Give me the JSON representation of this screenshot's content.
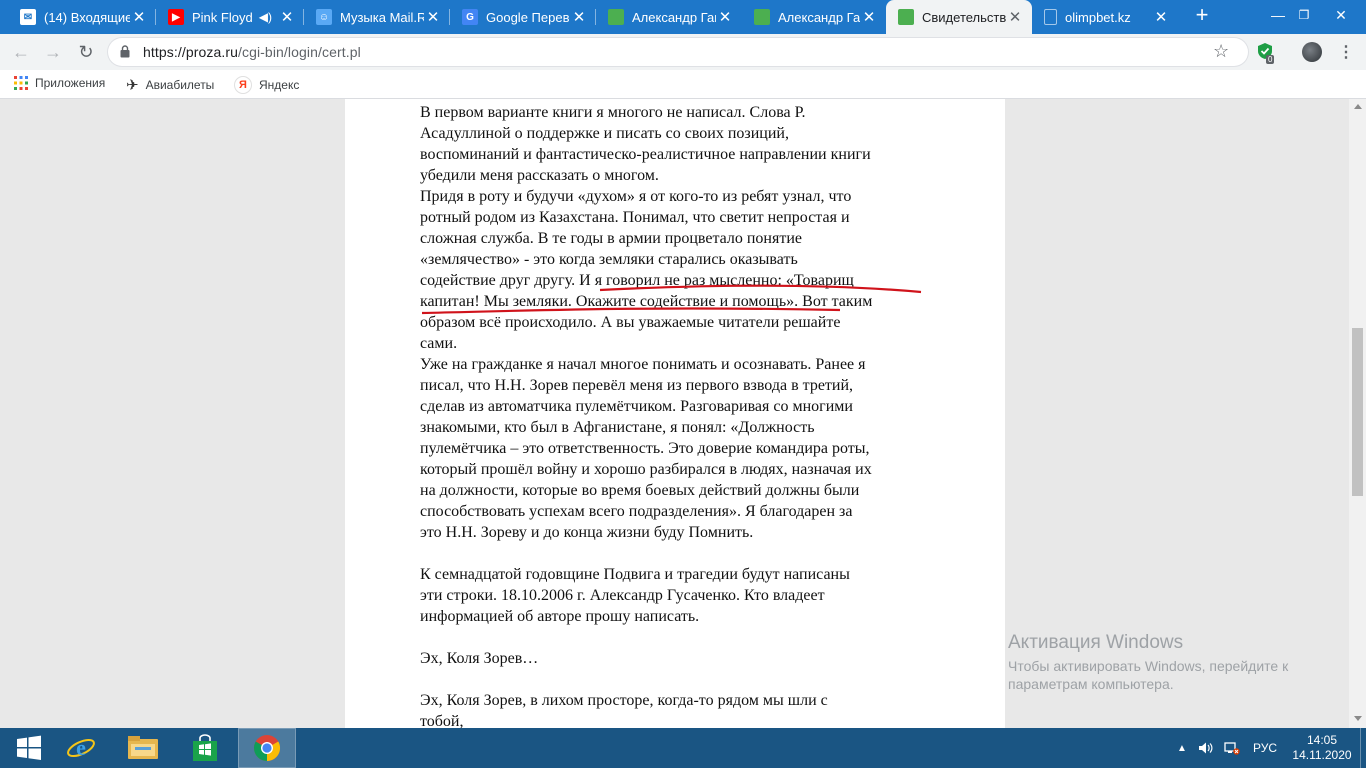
{
  "browser": {
    "tabs": [
      {
        "title": "(14) Входящие",
        "icon": "mail-icon",
        "active": false
      },
      {
        "title": "Pink Floyd",
        "icon": "youtube-icon",
        "active": false
      },
      {
        "title": "Музыка Mail.Ru",
        "icon": "mailru-music-icon",
        "active": false
      },
      {
        "title": "Google Перевод",
        "icon": "google-translate-icon",
        "active": false
      },
      {
        "title": "Александр Гащ",
        "icon": "proza-icon",
        "active": false
      },
      {
        "title": "Александр Гащ",
        "icon": "proza-icon",
        "active": false
      },
      {
        "title": "Свидетельство",
        "icon": "proza-icon",
        "active": true
      },
      {
        "title": "olimpbet.kz",
        "icon": "page-icon",
        "active": false
      }
    ],
    "new_tab_symbol": "+",
    "address": {
      "scheme_host": "https://proza.ru",
      "path": "/cgi-bin/login/cert.pl"
    },
    "extension_badge": "0",
    "bookmarks": [
      {
        "label": "Приложения",
        "icon": "apps-grid-icon"
      },
      {
        "label": "Авиабилеты",
        "icon": "airplane-icon"
      },
      {
        "label": "Яндекс",
        "icon": "yandex-icon"
      }
    ]
  },
  "article": {
    "paragraph1": "В первом варианте книги я многого не написал. Слова Р.\nАсадуллиной о поддержке и писать со своих позиций,\nвоспоминаний и фантастическо-реалистичное направлении книги\nубедили меня рассказать о многом.\nПридя в роту и будучи «духом» я от кого-то из ребят узнал, что\nротный родом из Казахстана. Понимал, что светит непростая и\nсложная служба. В те годы в армии процветало понятие\n«землячество» - это когда земляки старались оказывать\nсодействие друг другу. И я говорил не раз мысленно: «Товарищ\nкапитан! Мы земляки. Окажите содействие и помощь». Вот таким\nобразом всё происходило. А вы уважаемые читатели решайте\nсами.\nУже на гражданке я начал многое понимать и осознавать. Ранее я\nписал, что Н.Н. Зорев перевёл меня из первого взвода в третий,\nсделав из автоматчика пулемётчиком. Разговаривая со многими\nзнакомыми, кто был в Афганистане, я понял: «Должность\nпулемётчика – это ответственность. Это доверие командира роты,\nкоторый прошёл войну и хорошо разбирался в людях, назначая их\nна должности, которые во время боевых действий должны были\nспособствовать успехам всего подразделения». Я благодарен за\nэто Н.Н. Зореву и до конца жизни буду Помнить.",
    "paragraph2": "К семнадцатой годовщине Подвига и трагедии будут написаны\nэти строки. 18.10.2006 г. Александр Гусаченко. Кто владеет\nинформацией об авторе прошу написать.",
    "paragraph3": "Эх, Коля Зорев…",
    "paragraph4": "Эх, Коля Зорев, в лихом просторе, когда-то рядом мы шли с\nтобой,"
  },
  "watermark": {
    "title": "Активация Windows",
    "line1": "Чтобы активировать Windows, перейдите к",
    "line2": "параметрам компьютера."
  },
  "taskbar": {
    "apps": [
      "start-button",
      "internet-explorer",
      "file-explorer",
      "windows-store",
      "chrome"
    ],
    "language": "РУС",
    "time": "14:05",
    "date": "14.11.2020"
  },
  "colors": {
    "tabstrip": "#1e77c9",
    "taskbar": "#1a5583",
    "annotation_red": "#d0131b",
    "proza_green": "#4caf50"
  }
}
